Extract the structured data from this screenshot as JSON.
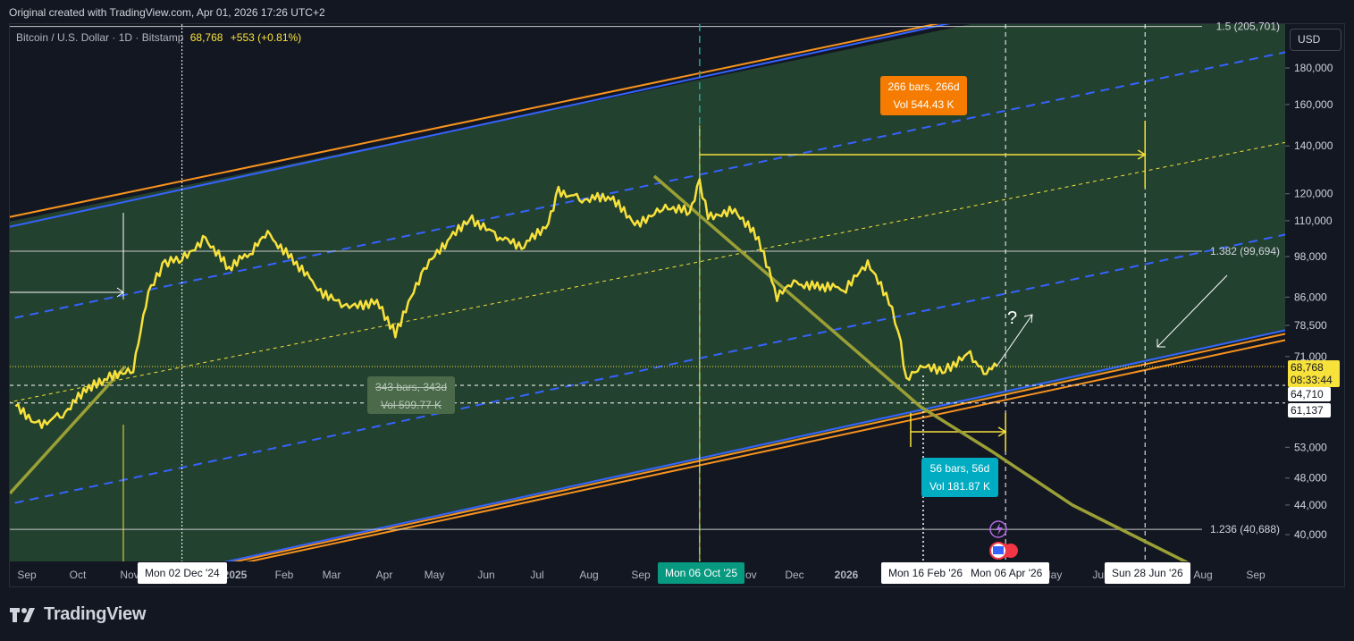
{
  "header": {
    "text": "Original created with TradingView.com, Apr 01, 2026 17:26 UTC+2"
  },
  "symbol": {
    "name": "Bitcoin / U.S. Dollar · 1D · Bitstamp",
    "price": "68,768",
    "change": "+553 (+0.81%)"
  },
  "currency_button": "USD",
  "brand": "TradingView",
  "chart_data": {
    "type": "line",
    "title": "Bitcoin / U.S. Dollar · 1D · Bitstamp",
    "y_scale": "log",
    "y_ticks": [
      "180,000",
      "160,000",
      "140,000",
      "120,000",
      "110,000",
      "98,000",
      "86,000",
      "78,500",
      "71,000",
      "53,000",
      "48,000",
      "44,000",
      "40,000"
    ],
    "x_ticks": [
      "Sep",
      "Oct",
      "Nov",
      "2025",
      "Feb",
      "Mar",
      "Apr",
      "May",
      "Jun",
      "Jul",
      "Aug",
      "Sep",
      "Nov",
      "Dec",
      "2026",
      "May",
      "Jul",
      "Aug",
      "Sep"
    ],
    "fib_levels": [
      {
        "label": "1.5 (205,701)",
        "value": 205701
      },
      {
        "label": "1.382 (99,694)",
        "value": 99694
      },
      {
        "label": "1.236 (40,688)",
        "value": 40688
      }
    ],
    "price_labels": [
      {
        "value": "68,768",
        "sub": "08:33:44",
        "color": "#f7e13b"
      },
      {
        "value": "64,710",
        "color": "#ffffff"
      },
      {
        "value": "61,137",
        "color": "#ffffff"
      }
    ],
    "date_badges": [
      {
        "label": "Mon 02 Dec '24",
        "date": "2024-12-02",
        "style": "light"
      },
      {
        "label": "Mon 06 Oct '25",
        "date": "2025-10-06",
        "style": "teal"
      },
      {
        "label": "Mon 16 Feb '26",
        "date": "2026-02-16",
        "style": "light"
      },
      {
        "label": "Mon 06 Apr '26",
        "date": "2026-04-06",
        "style": "light"
      },
      {
        "label": "Sun 28 Jun '26",
        "date": "2026-06-28",
        "style": "light"
      }
    ],
    "measurements": [
      {
        "line1": "266 bars, 266d",
        "line2": "Vol 544.43 K",
        "color": "#f57c00"
      },
      {
        "line1": "343 bars, 343d",
        "line2": "Vol 599.77 K",
        "color": "#4a6a4a"
      },
      {
        "line1": "56 bars, 56d",
        "line2": "Vol 181.87 K",
        "color": "#00acc1"
      }
    ],
    "annotation": "?",
    "series": [
      {
        "name": "BTCUSD",
        "color": "#f7e13b",
        "x": [
          "2024-08-25",
          "2024-09-08",
          "2024-09-22",
          "2024-10-06",
          "2024-10-20",
          "2024-11-03",
          "2024-11-12",
          "2024-11-22",
          "2024-12-02",
          "2024-12-16",
          "2024-12-30",
          "2025-01-13",
          "2025-01-22",
          "2025-02-05",
          "2025-02-24",
          "2025-03-10",
          "2025-03-28",
          "2025-04-08",
          "2025-04-25",
          "2025-05-09",
          "2025-05-22",
          "2025-06-06",
          "2025-06-22",
          "2025-07-08",
          "2025-07-14",
          "2025-07-28",
          "2025-08-14",
          "2025-08-30",
          "2025-09-14",
          "2025-09-30",
          "2025-10-06",
          "2025-10-11",
          "2025-10-27",
          "2025-11-10",
          "2025-11-21",
          "2025-12-01",
          "2025-12-15",
          "2026-01-01",
          "2026-01-14",
          "2026-01-25",
          "2026-02-01",
          "2026-02-06",
          "2026-02-16",
          "2026-03-01",
          "2026-03-16",
          "2026-03-24",
          "2026-04-01"
        ],
        "y": [
          60500,
          57000,
          59000,
          64000,
          66500,
          68500,
          88000,
          96000,
          97500,
          104000,
          94500,
          100000,
          105500,
          97500,
          87000,
          83000,
          84500,
          76500,
          94000,
          103000,
          111000,
          105000,
          101000,
          109000,
          121000,
          118000,
          119000,
          108500,
          115500,
          113500,
          124500,
          111500,
          114000,
          104000,
          86000,
          90000,
          89000,
          88500,
          95500,
          86500,
          78000,
          66000,
          68500,
          68000,
          71500,
          67500,
          68768
        ]
      }
    ]
  }
}
